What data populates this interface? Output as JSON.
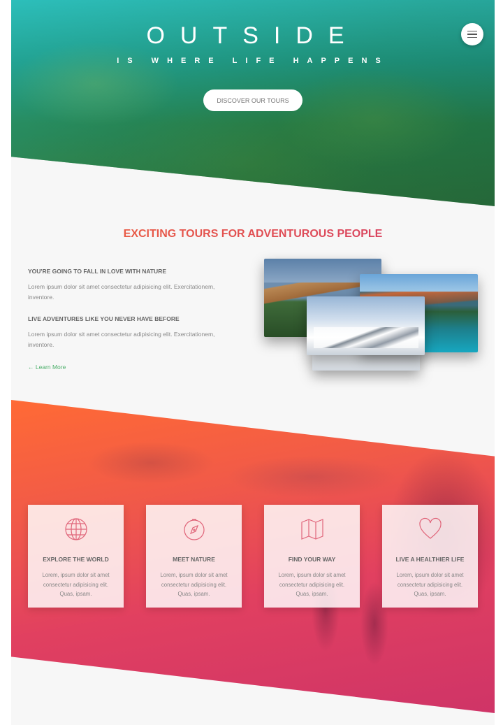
{
  "hero": {
    "brand": "OUTSIDE",
    "tagline": "IS WHERE LIFE HAPPENS",
    "cta_label": "DISCOVER OUR TOURS"
  },
  "about": {
    "title": "EXCITING TOURS FOR ADVENTUROUS PEOPLE",
    "items": [
      {
        "heading": "YOU'RE GOING TO FALL IN LOVE WITH NATURE",
        "text": "Lorem ipsum dolor sit amet consectetur adipisicing elit. Exercitationem, inventore."
      },
      {
        "heading": "LIVE ADVENTURES LIKE YOU NEVER HAVE BEFORE",
        "text": "Lorem ipsum dolor sit amet consectetur adipisicing elit. Exercitationem, inventore."
      }
    ],
    "learn_more": "← Learn More"
  },
  "features": [
    {
      "icon": "globe-icon",
      "title": "EXPLORE THE WORLD",
      "text": "Lorem, ipsum dolor sit amet consectetur adipisicing elit. Quas, ipsam."
    },
    {
      "icon": "compass-icon",
      "title": "MEET NATURE",
      "text": "Lorem, ipsum dolor sit amet consectetur adipisicing elit. Quas, ipsam."
    },
    {
      "icon": "map-icon",
      "title": "FIND YOUR WAY",
      "text": "Lorem, ipsum dolor sit amet consectetur adipisicing elit. Quas, ipsam."
    },
    {
      "icon": "heart-icon",
      "title": "LIVE A HEALTHIER LIFE",
      "text": "Lorem, ipsum dolor sit amet consectetur adipisicing elit. Quas, ipsam."
    }
  ],
  "colors": {
    "accent_start": "#f0643a",
    "accent_end": "#d23a6a",
    "link": "#4caf6a",
    "icon": "#e0657a"
  }
}
